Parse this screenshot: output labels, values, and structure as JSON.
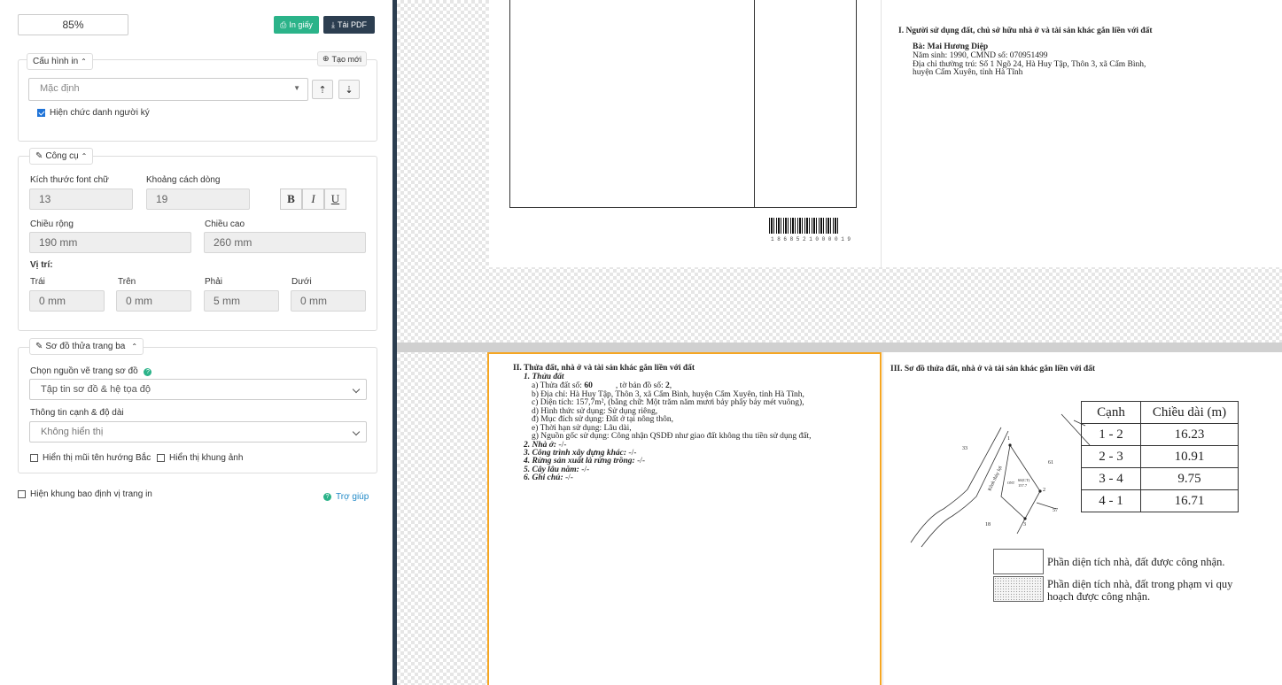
{
  "toolbar": {
    "zoom": "85%",
    "print_label": "In giấy",
    "pdf_label": "Tải PDF"
  },
  "config": {
    "legend": "Cấu hình in",
    "new_label": "Tạo mới",
    "template_value": "Mặc định",
    "show_title_label": "Hiện chức danh người ký",
    "show_title_checked": true
  },
  "tools": {
    "legend": "Công cụ",
    "font_size_label": "Kích thước font chữ",
    "font_size": "13",
    "line_spacing_label": "Khoảng cách dòng",
    "line_spacing": "19",
    "bold": "B",
    "italic": "I",
    "underline": "U",
    "width_label": "Chiều rộng",
    "width": "190 mm",
    "height_label": "Chiều cao",
    "height": "260 mm",
    "position_label": "Vị trí:",
    "left_label": "Trái",
    "left": "0 mm",
    "top_label": "Trên",
    "top": "0 mm",
    "right_label": "Phải",
    "right": "5 mm",
    "bottom_label": "Dưới",
    "bottom": "0 mm"
  },
  "diagram": {
    "legend": "Sơ đồ thửa trang ba",
    "source_label": "Chọn nguồn vẽ trang sơ đồ",
    "source_value": "Tập tin sơ đồ & hệ tọa độ",
    "edge_info_label": "Thông tin cạnh & độ dài",
    "edge_info_value": "Không hiển thị",
    "north_arrow_label": "Hiển thị mũi tên hướng Bắc",
    "frame_label": "Hiển thị khung ảnh"
  },
  "misc": {
    "bounding_label": "Hiện khung bao định vị trang in",
    "help_label": "Trợ giúp"
  },
  "preview": {
    "barcode_number": "1 8 6 8 5 2 1 0 0 0 0 1 9",
    "section1": {
      "title": "I. Người sử dụng đất, chủ sở hữu nhà ở và tài sản khác gắn liền với đất",
      "name": "Bà: Mai Hương Diệp",
      "line1": "Năm sinh: 1990, CMND số: 070951499",
      "line2": "Địa chỉ thường trú: Số 1 Ngõ 24, Hà Huy Tập, Thôn 3, xã Cẩm Bình,",
      "line3": "huyện Cẩm Xuyên, tỉnh Hà Tĩnh"
    },
    "section2": {
      "title": "II. Thửa đất, nhà ở và tài sản khác gắn liền với đất",
      "h1": "1. Thửa đất",
      "a_pre": "a) Thửa đất số: ",
      "a_num": "60",
      "a_mid": ", tờ bản đồ số: ",
      "a_map": "2",
      "a_end": ",",
      "b": "b) Địa chỉ: Hà Huy Tập, Thôn 3, xã Cẩm Bình, huyện Cẩm Xuyên, tỉnh Hà Tĩnh,",
      "c": "c) Diện tích: 157,7m², (bằng chữ: Một trăm năm mươi bảy phẩy bảy mét vuông),",
      "d": "d) Hình thức sử dụng: Sử dụng riêng,",
      "dd": "đ) Mục đích sử dụng: Đất ở tại nông thôn,",
      "e": "e) Thời hạn sử dụng: Lâu dài,",
      "g": "g) Nguồn gốc sử dụng: Công nhận QSDĐ như giao đất không thu tiền sử dụng đất,",
      "h2": "2. Nhà ở:",
      "h2v": " -/-",
      "h3": "3. Công trình xây dựng khác:",
      "h3v": " -/-",
      "h4": "4. Rừng sản xuất là rừng trồng:",
      "h4v": " -/-",
      "h5": "5. Cây lâu năm:",
      "h5v": " -/-",
      "h6": "6. Ghi chú:",
      "h6v": " -/-"
    },
    "section3": {
      "title": "III. Sơ đồ thửa đất, nhà ở và tài sản khác gắn liền với đất",
      "col_edge": "Cạnh",
      "col_length": "Chiều dài (m)",
      "rows": [
        {
          "edge": "1 - 2",
          "length": "16.23"
        },
        {
          "edge": "2 - 3",
          "length": "10.91"
        },
        {
          "edge": "3 - 4",
          "length": "9.75"
        },
        {
          "edge": "4 - 1",
          "length": "16.71"
        }
      ],
      "legend1": "Phần diện tích nhà, đất được công nhận.",
      "legend2a": "Phần diện tích nhà, đất trong phạm vi quy",
      "legend2b": "hoạch được công nhận.",
      "map_labels": {
        "p1": "1",
        "p2": "2",
        "p3": "3",
        "n33": "33",
        "n61": "61",
        "n57": "57",
        "n18": "18",
        "canal": "Kênh thủy lợi",
        "parcel": "60(CT)",
        "area": "157.7",
        "odt": "ONT"
      }
    }
  }
}
